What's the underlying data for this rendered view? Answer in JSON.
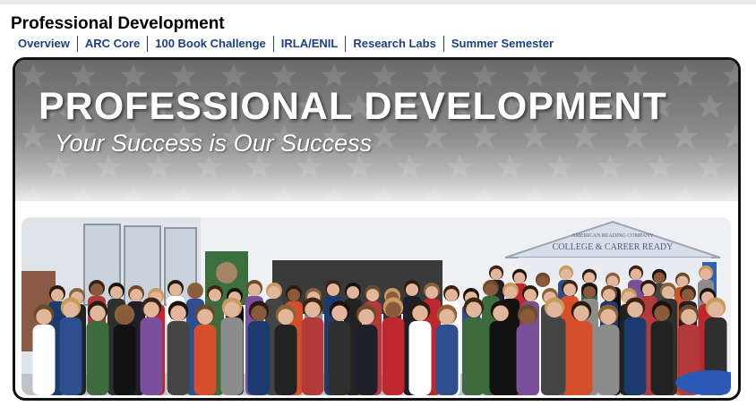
{
  "header": {
    "title": "Professional Development"
  },
  "nav": {
    "items": [
      {
        "label": "Overview"
      },
      {
        "label": "ARC Core"
      },
      {
        "label": "100 Book Challenge"
      },
      {
        "label": "IRLA/ENIL"
      },
      {
        "label": "Research Labs"
      },
      {
        "label": "Summer Semester"
      }
    ]
  },
  "banner": {
    "title": "PROFESSIONAL DEVELOPMENT",
    "subtitle": "Your Success is Our Success"
  },
  "photo": {
    "sign_top": "AMERICAN READING COMPANY",
    "sign_main": "COLLEGE & CAREER READY"
  },
  "colors": {
    "nav_link": "#1d3f84",
    "banner_dark": "#6a6a6a",
    "card_border": "#111111"
  }
}
